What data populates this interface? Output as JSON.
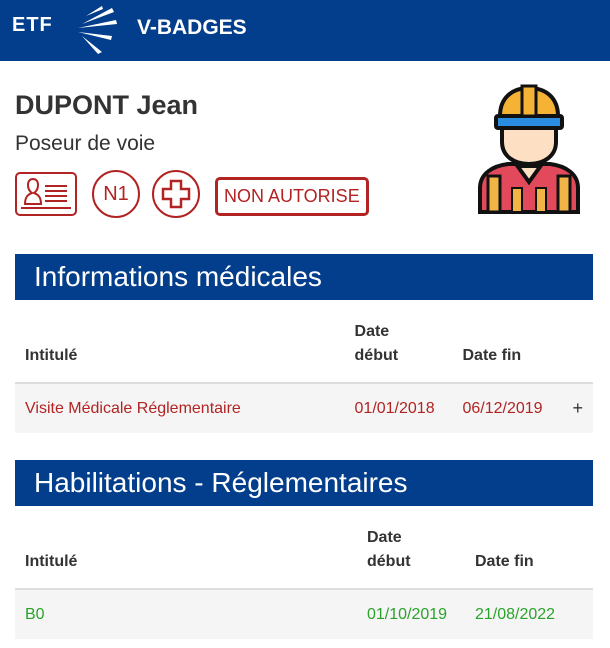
{
  "header": {
    "logo_text": "ETF",
    "app_title": "V-BADGES"
  },
  "person": {
    "name": "DUPONT Jean",
    "role": "Poseur de voie",
    "level_badge": "N1",
    "status_badge": "NON AUTORISE"
  },
  "colors": {
    "brand_blue": "#033e8c",
    "alert_red": "#b22323",
    "valid_green": "#2aa22a"
  },
  "medical": {
    "title": "Informations médicales",
    "columns": {
      "title": "Intitulé",
      "start_line1": "Date",
      "start_line2": "début",
      "end": "Date fin"
    },
    "rows": [
      {
        "title": "Visite Médicale Réglementaire",
        "start": "01/01/2018",
        "end": "06/12/2019",
        "action": "+"
      }
    ]
  },
  "habilitations": {
    "title": "Habilitations - Réglementaires",
    "columns": {
      "title": "Intitulé",
      "start_line1": "Date",
      "start_line2": "début",
      "end": "Date fin"
    },
    "rows": [
      {
        "title": "B0",
        "start": "01/10/2019",
        "end": "21/08/2022"
      }
    ]
  },
  "icons": {
    "logo": "etf-logo",
    "id_card": "id-card-icon",
    "medical_cross": "medical-cross-icon",
    "avatar": "worker-avatar-icon",
    "expand": "plus-icon"
  }
}
